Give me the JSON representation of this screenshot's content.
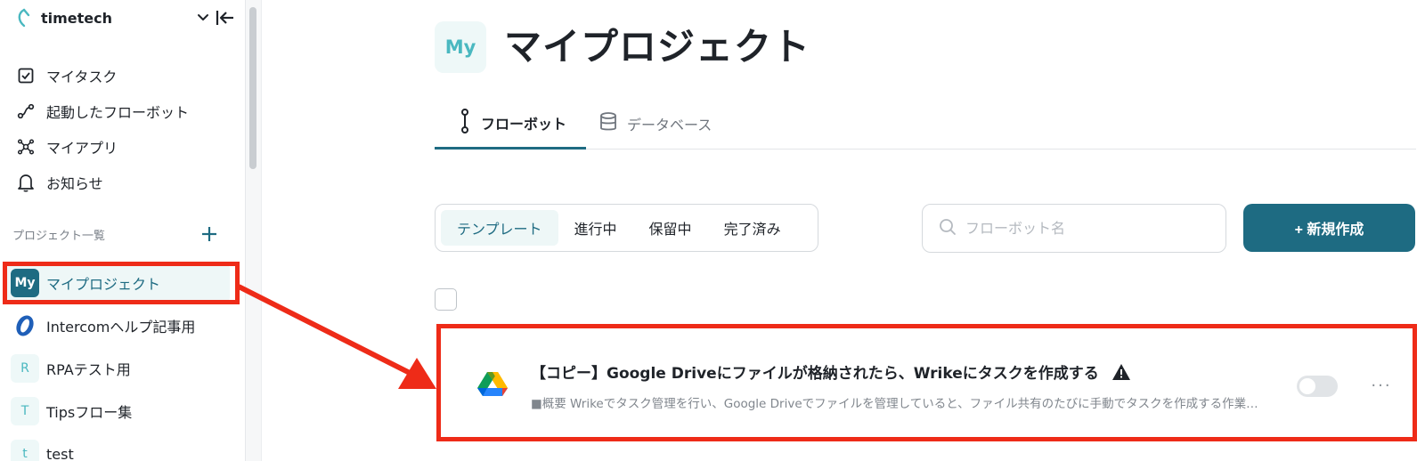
{
  "sidebar": {
    "workspace_name": "timetech",
    "nav": [
      {
        "label": "マイタスク",
        "icon": "checkbox-icon"
      },
      {
        "label": "起動したフローボット",
        "icon": "flow-icon"
      },
      {
        "label": "マイアプリ",
        "icon": "apps-icon"
      },
      {
        "label": "お知らせ",
        "icon": "bell-icon"
      }
    ],
    "section_title": "プロジェクト一覧",
    "projects": [
      {
        "badge": "My",
        "label": "マイプロジェクト",
        "active": true
      },
      {
        "badge": "",
        "label": "Intercomヘルプ記事用",
        "icon": "intercom-icon"
      },
      {
        "badge": "R",
        "label": "RPAテスト用"
      },
      {
        "badge": "T",
        "label": "Tipsフロー集"
      },
      {
        "badge": "t",
        "label": "test"
      }
    ]
  },
  "main": {
    "badge": "My",
    "title": "マイプロジェクト",
    "tabs": [
      {
        "label": "フローボット",
        "icon": "flowbot-icon",
        "active": true
      },
      {
        "label": "データベース",
        "icon": "database-icon",
        "active": false
      }
    ],
    "filters": [
      "テンプレート",
      "進行中",
      "保留中",
      "完了済み"
    ],
    "active_filter": "テンプレート",
    "search_placeholder": "フローボット名",
    "new_button": "+ 新規作成",
    "flowbots": [
      {
        "title": "【コピー】Google Driveにファイルが格納されたら、Wrikeにタスクを作成する",
        "description": "■概要 Wrikeでタスク管理を行い、Google Driveでファイルを管理していると、ファイル共有のたびに手動でタスクを作成する作業…",
        "app_icon": "google-drive-icon",
        "warning": true,
        "enabled": false,
        "more": "···"
      }
    ]
  },
  "colors": {
    "accent": "#1e6b82",
    "accent_light": "#eef7f7",
    "annotation": "#ee2b18"
  }
}
